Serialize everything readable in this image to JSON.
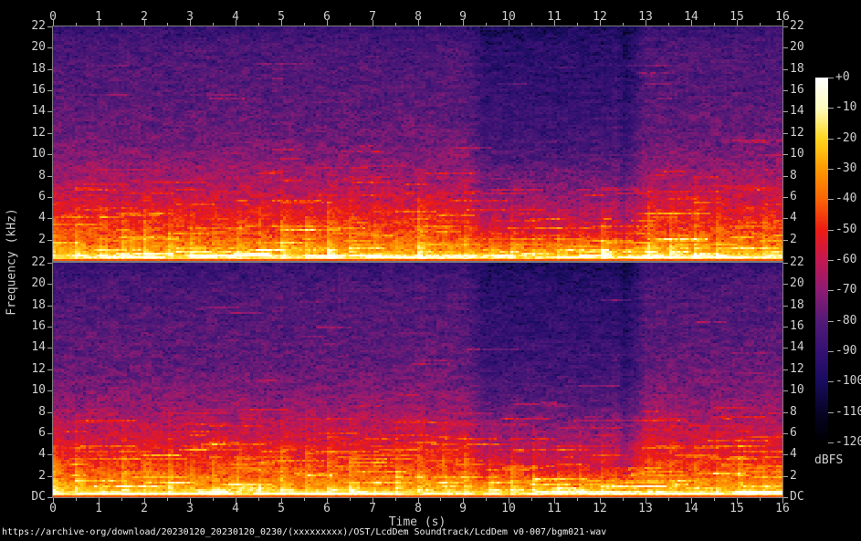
{
  "footer": {
    "url": "https://archive·org/download/20230120_20230120_0230/(xxxxxxxxx)/OST/LcdDem Soundtrack/LcdDem v0·007/bgm021·wav"
  },
  "colors": {
    "background": "#000000",
    "frame": "#7d7d7d",
    "tick": "#a8a8a8",
    "label_text": "#cfcfcf",
    "url_text": "#f2f2f2"
  },
  "chart_data": {
    "type": "heatmap",
    "subtype": "stereo-audio-spectrogram",
    "title": "",
    "xlabel": "Time (s)",
    "ylabel": "Frequency (kHz)",
    "x_range_s": [
      0,
      16
    ],
    "x_minor_step_s": 0.5,
    "y_range_khz": [
      0,
      22
    ],
    "x_ticks": [
      "0",
      "1",
      "2",
      "3",
      "4",
      "5",
      "6",
      "7",
      "8",
      "9",
      "10",
      "11",
      "12",
      "13",
      "14",
      "15",
      "16"
    ],
    "panels": [
      {
        "name": "channel-1-top",
        "y_ticks": [
          "22",
          "20",
          "18",
          "16",
          "14",
          "12",
          "10",
          "8",
          "6",
          "4",
          "2"
        ]
      },
      {
        "name": "channel-2-bottom",
        "y_ticks": [
          "22",
          "20",
          "18",
          "16",
          "14",
          "12",
          "10",
          "8",
          "6",
          "4",
          "2",
          "DC"
        ]
      }
    ],
    "colorbar": {
      "label": "dBFS",
      "min_db": -120,
      "max_db": 0,
      "ticks": [
        "+0",
        "-10",
        "-20",
        "-30",
        "-40",
        "-50",
        "-60",
        "-70",
        "-80",
        "-90",
        "-100",
        "-110",
        "-120"
      ]
    },
    "palette_stops_db_hex": [
      [
        -120,
        "#000000"
      ],
      [
        -110,
        "#070425"
      ],
      [
        -100,
        "#180c5e"
      ],
      [
        -90,
        "#341173"
      ],
      [
        -80,
        "#541a78"
      ],
      [
        -70,
        "#8c1c74"
      ],
      [
        -60,
        "#c41852"
      ],
      [
        -50,
        "#ee1c14"
      ],
      [
        -40,
        "#fa6406"
      ],
      [
        -30,
        "#ff9a02"
      ],
      [
        -20,
        "#ffd61e"
      ],
      [
        -10,
        "#fffcbe"
      ],
      [
        0,
        "#ffffff"
      ]
    ],
    "generation": {
      "seeds": [
        20230120,
        20230121
      ],
      "freq_profile_khz_db": [
        [
          0,
          -20
        ],
        [
          0.45,
          -18
        ],
        [
          0.8,
          -27
        ],
        [
          1.2,
          -33
        ],
        [
          1.8,
          -39
        ],
        [
          2.5,
          -44
        ],
        [
          3.5,
          -49
        ],
        [
          4.5,
          -53
        ],
        [
          5.5,
          -57
        ],
        [
          6.5,
          -61
        ],
        [
          8,
          -66
        ],
        [
          10,
          -72
        ],
        [
          12,
          -76
        ],
        [
          14,
          -78
        ],
        [
          16,
          -80
        ],
        [
          18,
          -81
        ],
        [
          20,
          -83
        ],
        [
          22,
          -89
        ]
      ],
      "dc_edge_db": -44,
      "beat": {
        "period_s": 0.5,
        "boost_db": 13,
        "decay": 5.5,
        "freq_fade_khz": 8.5
      },
      "quiet_sections": [
        {
          "start_s": 9.3,
          "end_s": 12.35,
          "att_db": 10
        },
        {
          "start_s": 12.35,
          "end_s": 12.7,
          "att_db": 15
        }
      ],
      "streaks": {
        "count": 260,
        "min_db": 5,
        "max_db": 14
      },
      "noise_db": 4.5,
      "block_noise_db": 4
    }
  }
}
